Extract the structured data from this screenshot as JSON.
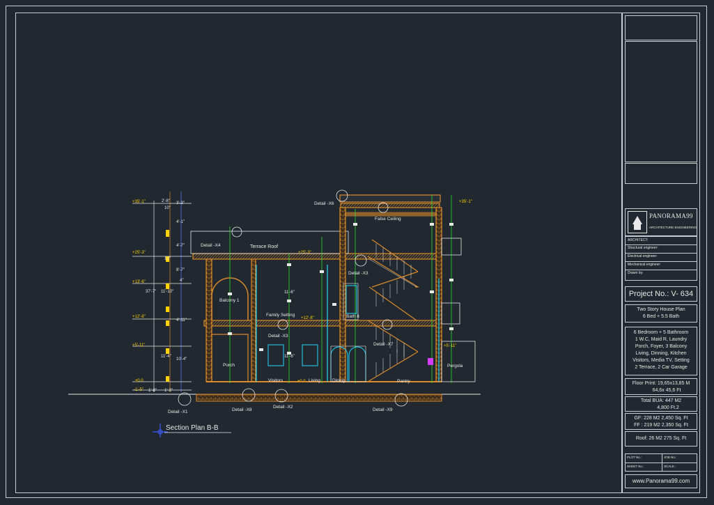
{
  "drawing": {
    "section_title": "Section Plan B-B",
    "room_labels": {
      "terrace_roof": "Terrace Roof",
      "balcony": "Balcony 1",
      "family_setting": "Family Setting",
      "bath": "Bath 8",
      "false_ceiling": "False Ceiling",
      "porch": "Porch",
      "visitors": "Visitors",
      "living": "Living",
      "dining": "Dining",
      "pantry": "Pantry",
      "pergola": "Pergola"
    },
    "detail_tags": {
      "x1": "Detail -X1",
      "x2": "Detail -X2",
      "x3a": "Detail -X3",
      "x3b": "Detail -X3",
      "x4": "Detail -X4",
      "x6": "Detail -X6",
      "x7": "Detail -X7",
      "x8": "Detail -X8",
      "x9": "Detail -X9"
    },
    "level_marks": {
      "l35": "+35'-1\"",
      "l25": "+25'-3\"",
      "l13": "+13'-6\"",
      "l12": "+12'-8\"",
      "l5": "+5'-11\"",
      "l0": "±0.0",
      "lneg": "-1'-5\"",
      "r35": "+35'-1\"",
      "mid_a": "+25'-3\"",
      "mid_b": "+12'-8\"",
      "floor0": "±0.0",
      "r5": "+5'-11\""
    },
    "dimensions": {
      "d_2_8": "2'-8\"",
      "d_3_3": "3'-3\"",
      "d_4_1": "4'-1\"",
      "d_37_7": "37'-7\"",
      "d_11_10": "11'-10\"",
      "d_10a": "10\"",
      "d_10b": "10\"",
      "d_4_11": "4'-11\"",
      "d_11_4": "11'-4\"",
      "d_10_4": "10'-4\"",
      "d_1_8": "1'-8\"",
      "d_1_3": "1'-3\"",
      "d_8_7": "8'-7\"",
      "d_4_7": "4'-7\"",
      "d_4": "4\"",
      "d_11_6a": "11'-6\"",
      "d_11_6b": "11'-6\""
    }
  },
  "title_block": {
    "logo_name": "PANORAMA99",
    "logo_sub": "ARCHITECTURE ENGINEERING",
    "roles": [
      "ARCHITECT:",
      "Structural engineer:",
      "Electrical engineer:",
      "Mechanical engineer:",
      "Drawn by:"
    ],
    "project_no": "Project No.: V- 634",
    "plan_title_1": "Two Story House Plan",
    "plan_title_2": "6 Bed + 5.5 Bath",
    "desc_lines": [
      "6 Bedroom + 5 Bathroom",
      "1 W.C, Maid R, Laundry",
      "Porch, Foyer, 3 Balcony",
      "Living, Dinning, Kitchen",
      "Visitors, Media TV, Setting",
      "2 Terrace, 2 Car Garage"
    ],
    "floor_print_1": "Floor Print: 19,65x13,85 M",
    "floor_print_2": "64,6x 45,6 Ft",
    "total_bua_1": "Total BUA:  447     M2",
    "total_bua_2": "4,800  Ft.2",
    "gf": "GF: 228 M2  2,450 Sq. Ft",
    "ff": "FF : 219 M2  2,350 Sq. Ft",
    "roof": "Roof:  26 M2  275 Sq. Ft",
    "plot_no": "PLOT No.:",
    "job_no": "JOB No.:",
    "sheet_no": "SHEET No.:",
    "scale": "SCALE.:",
    "website": "www.Panorama99.com"
  }
}
